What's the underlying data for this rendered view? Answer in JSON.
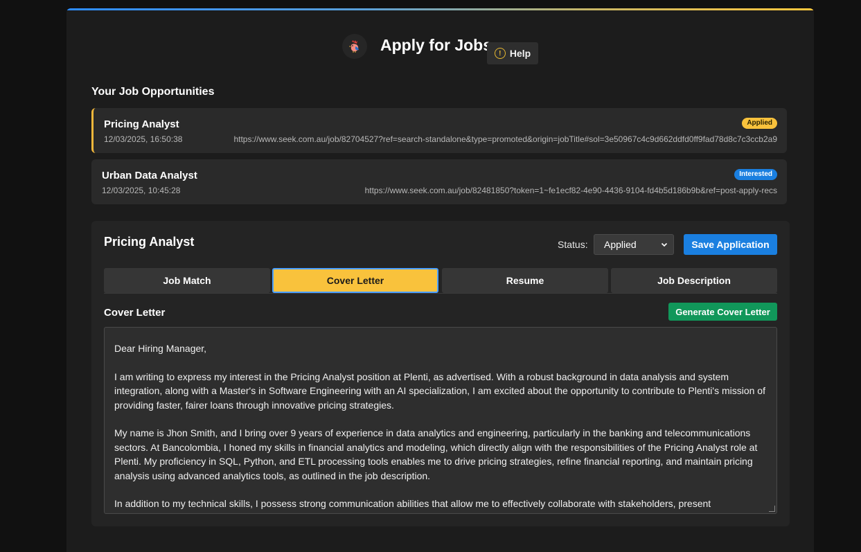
{
  "header": {
    "title": "Apply for Jobs",
    "help_label": "Help",
    "help_icon": "alert-circle-icon",
    "logo_icon": "rooster-logo-icon"
  },
  "opportunities": {
    "section_title": "Your Job Opportunities",
    "items": [
      {
        "title": "Pricing Analyst",
        "date": "12/03/2025, 16:50:38",
        "url": "https://www.seek.com.au/job/82704527?ref=search-standalone&type=promoted&origin=jobTitle#sol=3e50967c4c9d662ddfd0ff9fad78d8c7c3ccb2a9",
        "status": "Applied",
        "selected": true
      },
      {
        "title": "Urban Data Analyst",
        "date": "12/03/2025, 10:45:28",
        "url": "https://www.seek.com.au/job/82481850?token=1~fe1ecf82-4e90-4436-9104-fd4b5d186b9b&ref=post-apply-recs",
        "status": "Interested",
        "selected": false
      }
    ]
  },
  "detail": {
    "title": "Pricing Analyst",
    "status_label": "Status:",
    "status_value": "Applied",
    "save_label": "Save Application",
    "tabs": [
      {
        "label": "Job Match",
        "active": false
      },
      {
        "label": "Cover Letter",
        "active": true
      },
      {
        "label": "Resume",
        "active": false
      },
      {
        "label": "Job Description",
        "active": false
      }
    ],
    "cover_letter": {
      "heading": "Cover Letter",
      "generate_label": "Generate Cover Letter",
      "paragraphs": [
        "Dear Hiring Manager,",
        "I am writing to express my interest in the Pricing Analyst position at Plenti, as advertised. With a robust background in data analysis and system integration, along with a Master's in Software Engineering with an AI specialization, I am excited about the opportunity to contribute to Plenti's mission of providing faster, fairer loans through innovative pricing strategies.",
        "My name is Jhon Smith, and I bring over 9 years of experience in data analytics and engineering, particularly in the banking and telecommunications sectors. At Bancolombia, I honed my skills in financial analytics and modeling, which directly align with the responsibilities of the Pricing Analyst role at Plenti. My proficiency in SQL, Python, and ETL processing tools enables me to drive pricing strategies, refine financial reporting, and maintain pricing analysis using advanced analytics tools, as outlined in the job description.",
        "In addition to my technical skills, I possess strong communication abilities that allow me to effectively collaborate with stakeholders, present"
      ]
    }
  },
  "colors": {
    "accent_blue": "#1a7fe0",
    "accent_yellow": "#f9c23c",
    "accent_green": "#11975a",
    "background": "#1c1c1c"
  }
}
